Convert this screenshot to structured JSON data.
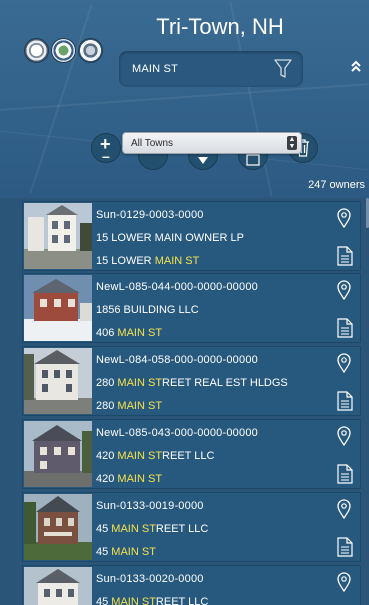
{
  "header": {
    "title": "Tri-Town, NH",
    "search_value": "MAIN ST",
    "town_select_value": "All Towns",
    "owner_count": "247 owners"
  },
  "colors": {
    "background": "#2a5478",
    "card": "#27597f",
    "highlight": "#f5e24a",
    "select": "#e6e9ec"
  },
  "icons": [
    "filter-icon",
    "collapse-up-icon",
    "add-icon",
    "pin-icon",
    "document-icon",
    "trash-icon"
  ],
  "results": [
    {
      "id": "Sun-0129-0003-0000",
      "owner_pre": "15 LOWER MAIN OWNER LP",
      "owner_hl": "",
      "owner_post": "",
      "addr_pre": "15 LOWER ",
      "addr_hl": "MAIN ST",
      "addr_post": ""
    },
    {
      "id": "NewL-085-044-000-0000-00000",
      "owner_pre": "1856 BUILDING LLC",
      "owner_hl": "",
      "owner_post": "",
      "addr_pre": "406 ",
      "addr_hl": "MAIN ST",
      "addr_post": ""
    },
    {
      "id": "NewL-084-058-000-0000-00000",
      "owner_pre": "280 ",
      "owner_hl": "MAIN ST",
      "owner_post": "REET REAL EST HLDGS",
      "addr_pre": "280 ",
      "addr_hl": "MAIN ST",
      "addr_post": ""
    },
    {
      "id": "NewL-085-043-000-0000-00000",
      "owner_pre": "420 ",
      "owner_hl": "MAIN ST",
      "owner_post": "REET LLC",
      "addr_pre": "420 ",
      "addr_hl": "MAIN ST",
      "addr_post": ""
    },
    {
      "id": "Sun-0133-0019-0000",
      "owner_pre": "45 ",
      "owner_hl": "MAIN ST",
      "owner_post": "REET LLC",
      "addr_pre": "45 ",
      "addr_hl": "MAIN ST",
      "addr_post": ""
    },
    {
      "id": "Sun-0133-0020-0000",
      "owner_pre": "45 ",
      "owner_hl": "MAIN ST",
      "owner_post": "REET LLC",
      "addr_pre": "",
      "addr_hl": "",
      "addr_post": ""
    }
  ]
}
